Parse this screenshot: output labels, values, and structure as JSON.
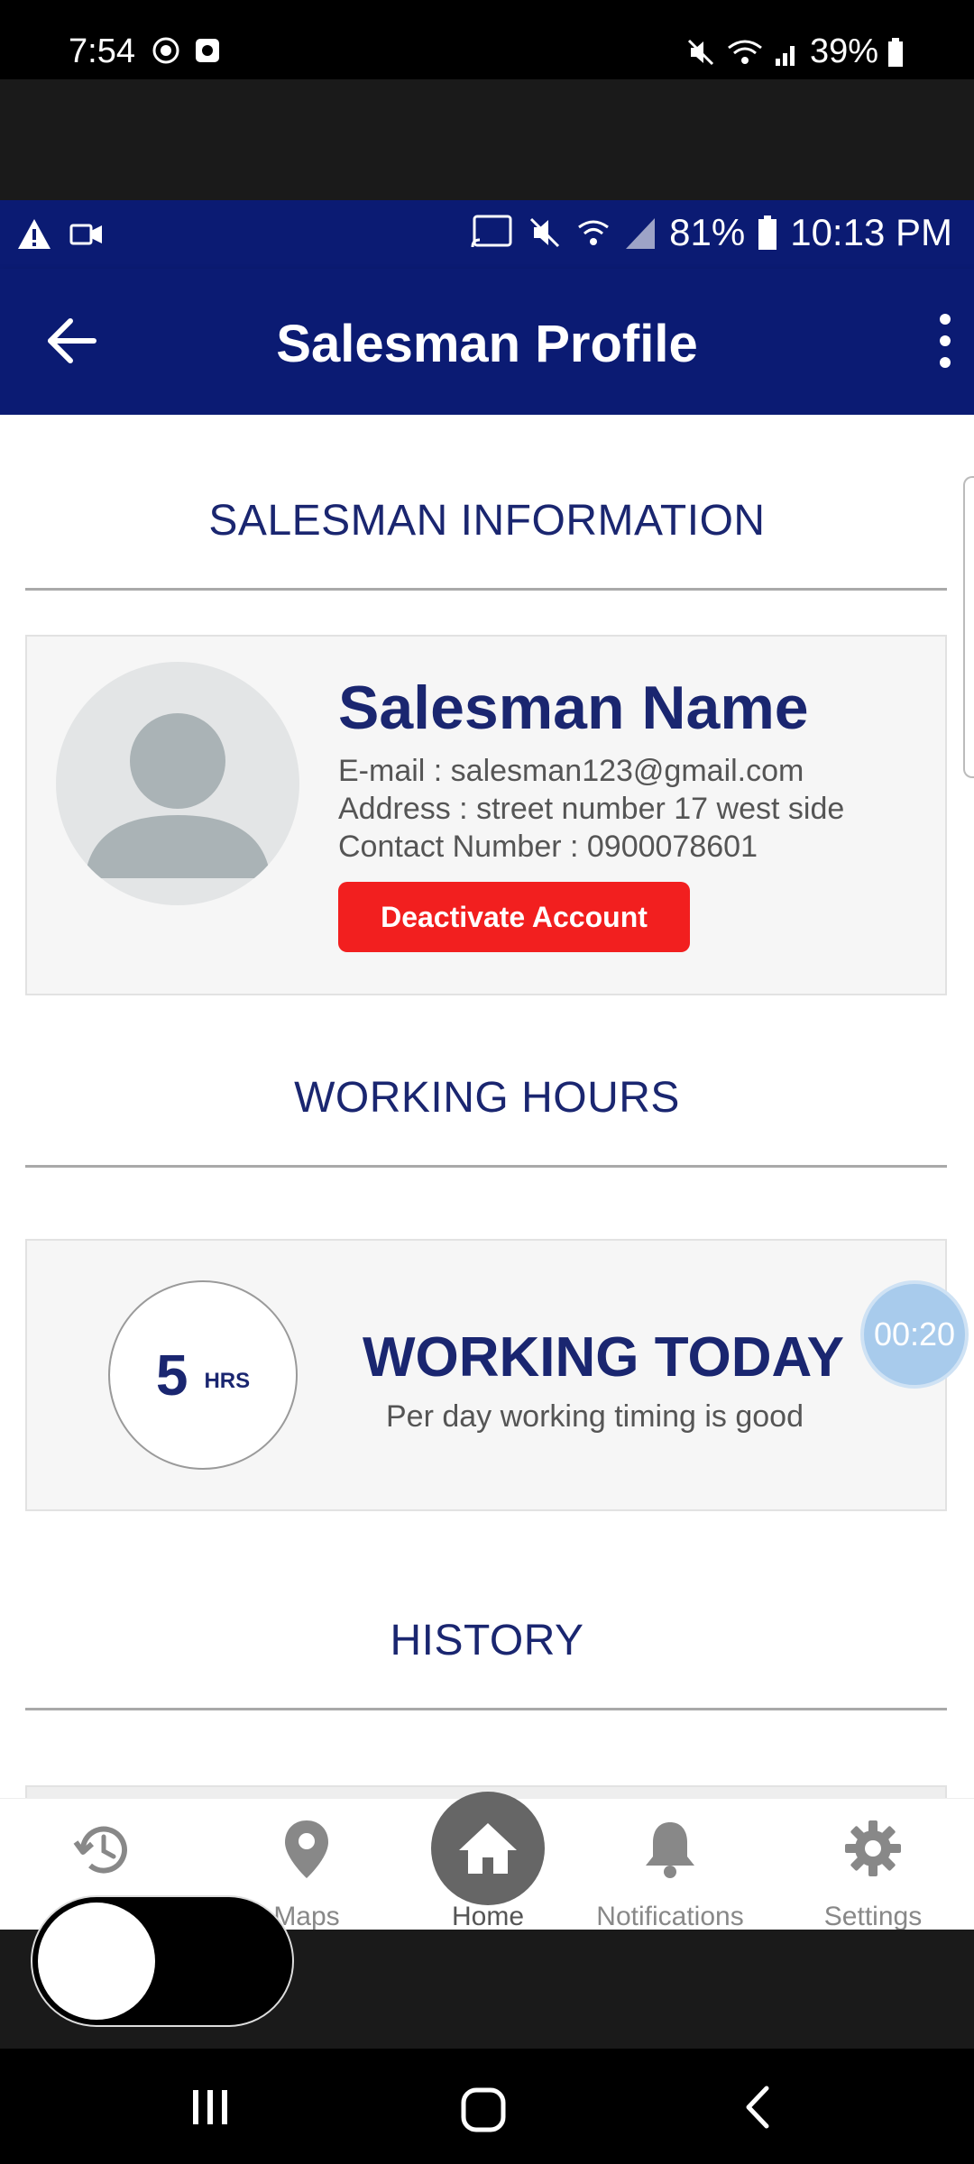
{
  "outer_status": {
    "time": "7:54",
    "battery": "39%"
  },
  "app_status": {
    "battery": "81%",
    "time": "10:13 PM"
  },
  "app_bar": {
    "title": "Salesman Profile"
  },
  "salesman_section": {
    "heading": "SALESMAN INFORMATION",
    "name": "Salesman Name",
    "email": "E-mail : salesman123@gmail.com",
    "address": "Address : street number 17 west side",
    "contact": "Contact Number : 0900078601",
    "deactivate_label": "Deactivate Account"
  },
  "working_section": {
    "heading": "WORKING HOURS",
    "hours": "5",
    "hours_unit": "HRS",
    "title": "WORKING TODAY",
    "subtitle": "Per day working timing is good"
  },
  "timer": "00:20",
  "history_section": {
    "heading": "HISTORY"
  },
  "bottom_nav": {
    "items": [
      {
        "label": "",
        "icon": "history-icon"
      },
      {
        "label": "Maps",
        "icon": "map-pin-icon"
      },
      {
        "label": "Home",
        "icon": "home-icon"
      },
      {
        "label": "Notifications",
        "icon": "bell-icon"
      },
      {
        "label": "Settings",
        "icon": "gear-icon"
      }
    ],
    "active": "Home"
  },
  "colors": {
    "primary": "#0b1b73",
    "accent_red": "#f21f1f",
    "heading_text": "#1a2670"
  }
}
